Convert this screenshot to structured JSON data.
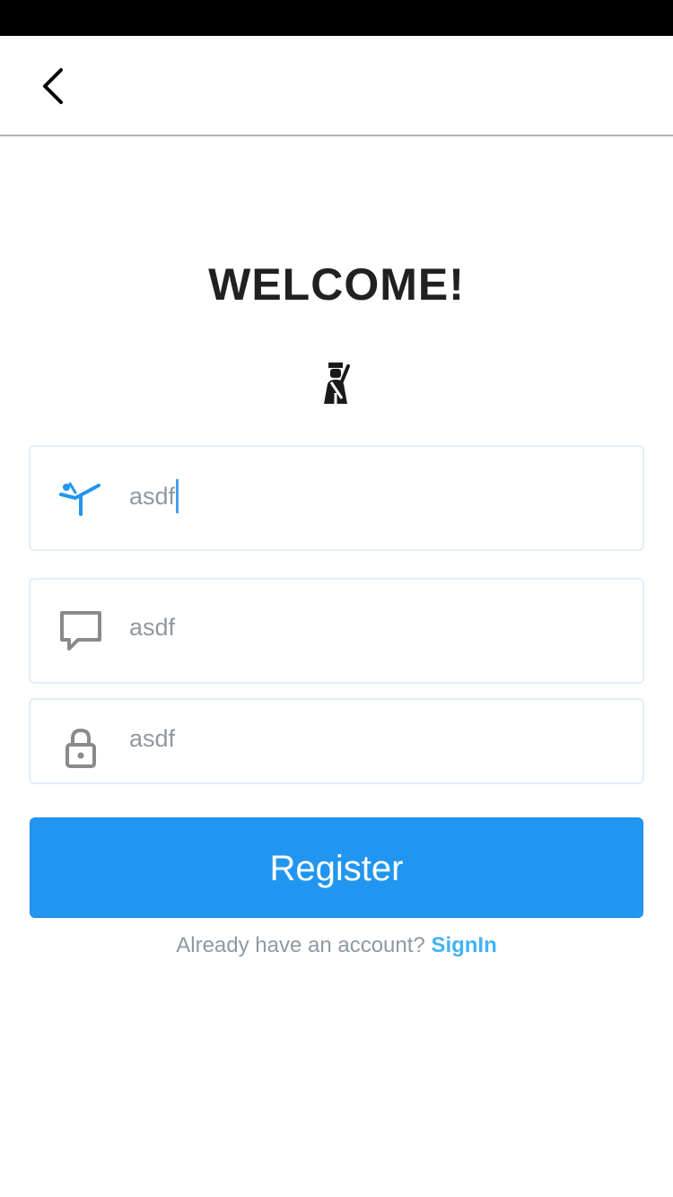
{
  "page": {
    "title": "WELCOME!"
  },
  "icons": {
    "back": "chevron-left-icon",
    "hero": "guard-icon",
    "username": "karate-kick-icon",
    "email": "message-icon",
    "password": "lock-icon"
  },
  "form": {
    "username_value": "asdf",
    "email_value": "asdf",
    "password_value": "asdf"
  },
  "register_label": "Register",
  "signin": {
    "prompt": "Already have an account?",
    "link": "SignIn"
  },
  "colors": {
    "accent": "#2196f0",
    "link": "#42b3f5",
    "status_bar": "#000000",
    "field_border": "#e3eef9",
    "placeholder_text": "#8e99a3"
  }
}
